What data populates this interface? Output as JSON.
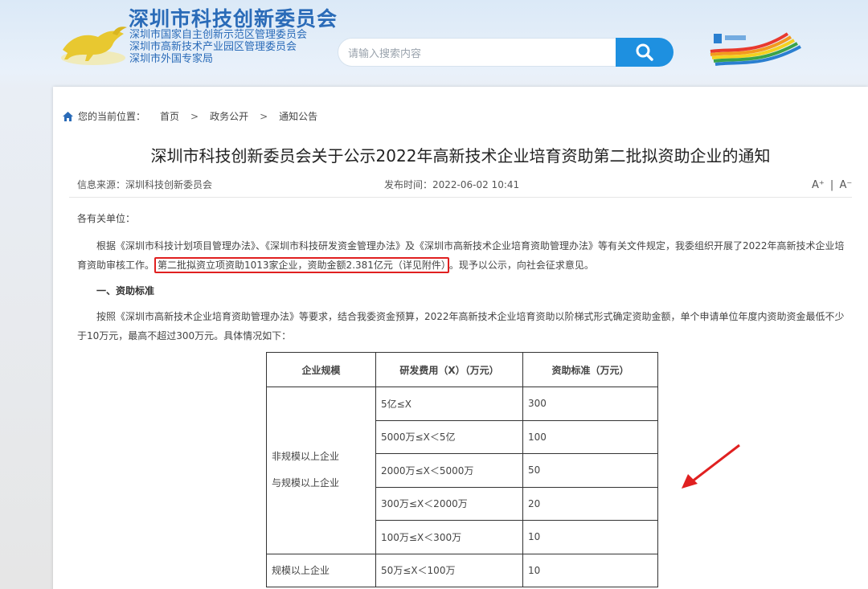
{
  "header": {
    "org_title": "深圳市科技创新委员会",
    "sub_orgs": [
      "深圳市国家自主创新示范区管理委员会",
      "深圳市高新技术产业园区管理委员会",
      "深圳市外国专家局"
    ],
    "search_placeholder": "请输入搜索内容",
    "search_icon": "search-icon"
  },
  "breadcrumb": {
    "prefix": "您的当前位置：",
    "items": [
      "首页",
      "政务公开",
      "通知公告"
    ],
    "separator": ">"
  },
  "article": {
    "title": "深圳市科技创新委员会关于公示2022年高新技术企业培育资助第二批拟资助企业的通知",
    "source": "信息来源：深圳科技创新委员会",
    "publish_time": "发布时间：2022-06-02 10:41",
    "font_increase": "A⁺",
    "font_divider": "|",
    "font_decrease": "A⁻",
    "greeting": "各有关单位：",
    "p1_before": "根据《深圳市科技计划项目管理办法》、《深圳市科技研发资金管理办法》及《深圳市高新技术企业培育资助管理办法》等有关文件规定，我委组织开展了2022年高新技术企业培育资助审核工作。",
    "p1_highlight": "第二批拟资立项资助1013家企业，资助金额2.381亿元（详见附件）",
    "p1_after": "。现予以公示，向社会征求意见。",
    "section1": "一、资助标准",
    "p2": "按照《深圳市高新技术企业培育资助管理办法》等要求，结合我委资金预算，2022年高新技术企业培育资助以阶梯式形式确定资助金额，单个申请单位年度内资助资金最低不少于10万元，最高不超过300万元。具体情况如下："
  },
  "table": {
    "headers": [
      "企业规模",
      "研发费用（X）（万元）",
      "资助标准（万元）"
    ],
    "group1_label_line1": "非规模以上企业",
    "group1_label_line2": "与规模以上企业",
    "group1_rows": [
      {
        "range": "5亿≤X",
        "amount": "300"
      },
      {
        "range": "5000万≤X＜5亿",
        "amount": "100"
      },
      {
        "range": "2000万≤X＜5000万",
        "amount": "50"
      },
      {
        "range": "300万≤X＜2000万",
        "amount": "20"
      },
      {
        "range": "100万≤X＜300万",
        "amount": "10"
      }
    ],
    "group2_label": "规模以上企业",
    "group2_rows": [
      {
        "range": "50万≤X＜100万",
        "amount": "10"
      }
    ]
  },
  "colors": {
    "brand_blue": "#2a6bb8",
    "search_button": "#1e90e0",
    "highlight_red": "#e02020"
  }
}
